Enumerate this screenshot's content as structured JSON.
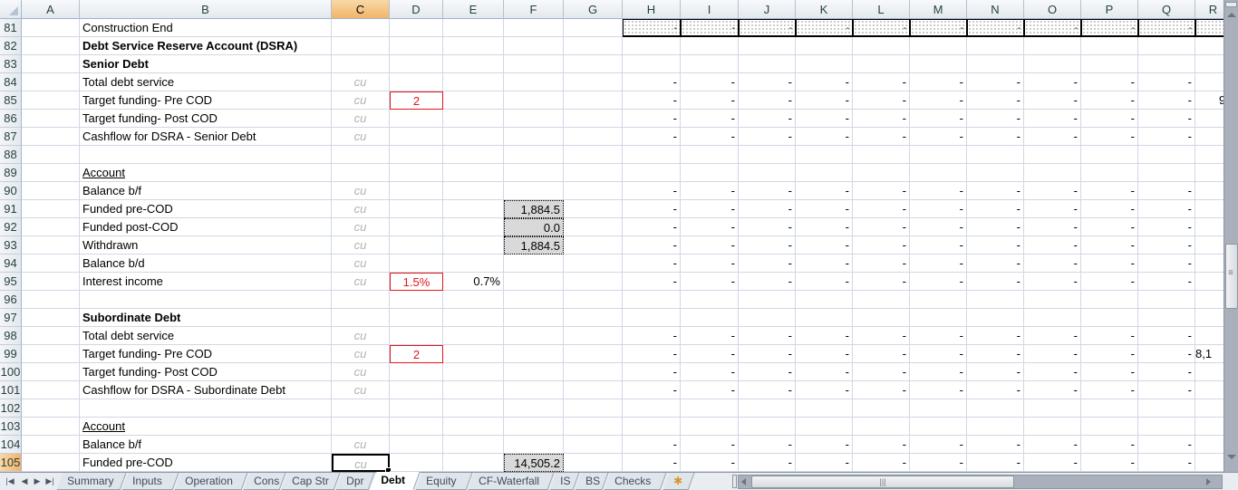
{
  "columns": [
    "A",
    "B",
    "C",
    "D",
    "E",
    "F",
    "G",
    "H",
    "I",
    "J",
    "K",
    "L",
    "M",
    "N",
    "O",
    "P",
    "Q",
    "R"
  ],
  "selected_column": "C",
  "selected_row": 105,
  "rows": [
    {
      "n": 81,
      "label": "Construction End",
      "style": "normal",
      "unit": "",
      "timeline": "pattern"
    },
    {
      "n": 82,
      "label": "Debt Service Reserve Account (DSRA)",
      "style": "bold",
      "unit": "",
      "timeline": "none"
    },
    {
      "n": 83,
      "label": "Senior Debt",
      "style": "bold",
      "unit": "",
      "timeline": "none"
    },
    {
      "n": 84,
      "label": "Total debt service",
      "style": "normal",
      "unit": "cu",
      "timeline": "dash"
    },
    {
      "n": 85,
      "label": "Target funding- Pre COD",
      "style": "normal",
      "unit": "cu",
      "D": "2",
      "timeline": "dash",
      "R": "9"
    },
    {
      "n": 86,
      "label": "Target funding- Post COD",
      "style": "normal",
      "unit": "cu",
      "timeline": "dash"
    },
    {
      "n": 87,
      "label": "Cashflow for DSRA - Senior Debt",
      "style": "normal",
      "unit": "cu",
      "timeline": "dash"
    },
    {
      "n": 88,
      "label": "",
      "style": "normal",
      "unit": "",
      "timeline": "none"
    },
    {
      "n": 89,
      "label": "Account",
      "style": "underline",
      "unit": "",
      "timeline": "none"
    },
    {
      "n": 90,
      "label": "Balance b/f",
      "style": "normal",
      "unit": "cu",
      "timeline": "dash"
    },
    {
      "n": 91,
      "label": "Funded pre-COD",
      "style": "normal",
      "unit": "cu",
      "F": "1,884.5",
      "timeline": "dash"
    },
    {
      "n": 92,
      "label": "Funded post-COD",
      "style": "normal",
      "unit": "cu",
      "F": "0.0",
      "timeline": "dash"
    },
    {
      "n": 93,
      "label": "Withdrawn",
      "style": "normal",
      "unit": "cu",
      "F": "1,884.5",
      "timeline": "dash"
    },
    {
      "n": 94,
      "label": "Balance b/d",
      "style": "normal",
      "unit": "cu",
      "timeline": "dash"
    },
    {
      "n": 95,
      "label": "Interest income",
      "style": "normal",
      "unit": "cu",
      "D": "1.5%",
      "E": "0.7%",
      "timeline": "dash"
    },
    {
      "n": 96,
      "label": "",
      "style": "normal",
      "unit": "",
      "timeline": "none"
    },
    {
      "n": 97,
      "label": "Subordinate Debt",
      "style": "bold",
      "unit": "",
      "timeline": "none"
    },
    {
      "n": 98,
      "label": "Total debt service",
      "style": "normal",
      "unit": "cu",
      "timeline": "dash"
    },
    {
      "n": 99,
      "label": "Target funding- Pre COD",
      "style": "normal",
      "unit": "cu",
      "D": "2",
      "timeline": "dash",
      "R": "8,1"
    },
    {
      "n": 100,
      "label": "Target funding- Post COD",
      "style": "normal",
      "unit": "cu",
      "timeline": "dash"
    },
    {
      "n": 101,
      "label": "Cashflow for DSRA - Subordinate Debt",
      "style": "normal",
      "unit": "cu",
      "timeline": "dash"
    },
    {
      "n": 102,
      "label": "",
      "style": "normal",
      "unit": "",
      "timeline": "none"
    },
    {
      "n": 103,
      "label": "Account",
      "style": "underline",
      "unit": "",
      "timeline": "none"
    },
    {
      "n": 104,
      "label": "Balance b/f",
      "style": "normal",
      "unit": "cu",
      "timeline": "dash"
    },
    {
      "n": 105,
      "label": "Funded pre-COD",
      "style": "normal",
      "unit": "cu",
      "F": "14,505.2",
      "timeline": "dash"
    }
  ],
  "dash_value": "-",
  "sheet_tabs": [
    "Summary",
    "Inputs",
    "Operation",
    "Cons",
    "Cap Str",
    "Dpr",
    "Debt",
    "Equity",
    "CF-Waterfall",
    "IS",
    "BS",
    "Checks"
  ],
  "active_tab": "Debt",
  "nav_buttons": [
    "first-sheet",
    "prev-sheet",
    "next-sheet",
    "last-sheet"
  ],
  "colors": {
    "input_red": "#e0161c",
    "unit_grey": "#b2b2b2",
    "selected_header": "#f1b46b",
    "gridline": "#d0d7e5"
  }
}
